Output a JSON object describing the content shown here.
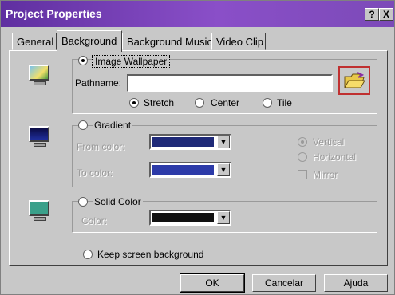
{
  "window": {
    "title": "Project Properties",
    "help_button": "?",
    "close_button": "X"
  },
  "tabs": [
    {
      "label": "General"
    },
    {
      "label": "Background"
    },
    {
      "label": "Background Music"
    },
    {
      "label": "Video Clip"
    }
  ],
  "image_wallpaper": {
    "label": "Image Wallpaper",
    "selected": true,
    "pathname_label": "Pathname:",
    "pathname_value": "",
    "options": [
      {
        "label": "Stretch",
        "selected": true
      },
      {
        "label": "Center",
        "selected": false
      },
      {
        "label": "Tile",
        "selected": false
      }
    ],
    "browse_icon": "open-folder-icon"
  },
  "gradient": {
    "label": "Gradient",
    "selected": false,
    "from_color_label": "From color:",
    "from_color": "#1f2a78",
    "to_color_label": "To color:",
    "to_color": "#2c3aa8",
    "direction": [
      {
        "label": "Vertical",
        "selected": true
      },
      {
        "label": "Horizontal",
        "selected": false
      }
    ],
    "mirror_label": "Mirror",
    "mirror_checked": false
  },
  "solid_color": {
    "label": "Solid Color",
    "selected": false,
    "color_label": "Color:",
    "color": "#111111"
  },
  "keep_screen": {
    "label": "Keep screen background",
    "selected": false
  },
  "buttons": {
    "ok": "OK",
    "cancel": "Cancelar",
    "help": "Ajuda"
  }
}
